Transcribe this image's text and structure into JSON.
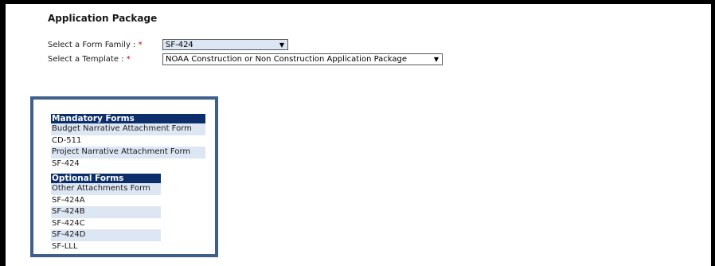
{
  "package": {
    "title": "Application Package",
    "family_label": "Select a Form Family :",
    "template_label": "Select a Template :",
    "required_mark": "*",
    "family_value": "SF-424",
    "template_value": "NOAA Construction or Non Construction Application Package",
    "dropdown_arrow": "▼"
  },
  "mandatory": {
    "heading": "Mandatory Forms",
    "items": [
      "Budget Narrative Attachment Form",
      "CD-511",
      "Project Narrative Attachment Form",
      "SF-424"
    ]
  },
  "optional": {
    "heading": "Optional Forms",
    "items": [
      "Other Attachments Form",
      "SF-424A",
      "SF-424B",
      "SF-424C",
      "SF-424D",
      "SF-LLL"
    ]
  },
  "colors": {
    "header_bg": "#0c2f6b",
    "alt_row_bg": "#dde6f3",
    "box_border": "#3d5f8a",
    "required": "#cc0000"
  }
}
